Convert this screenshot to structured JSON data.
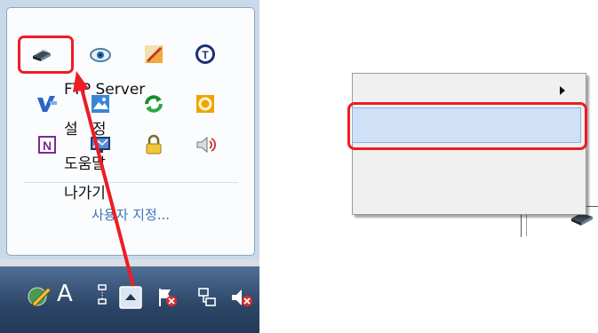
{
  "flyout": {
    "customize_label": "사용자 지정...",
    "icons": [
      "app-tray-icon",
      "eye-icon",
      "colorpicker-icon",
      "t-circle-icon",
      "vs-icon",
      "picture-icon",
      "green-sync-icon",
      "outlook-icon",
      "onenote-icon",
      "monitor-icon",
      "lock-icon",
      "speaker-icon"
    ]
  },
  "taskbar": {
    "font_label": "A",
    "icons": [
      "pencil-icon",
      "font-icon",
      "network-small-icon",
      "show-hidden-icons-button",
      "action-center-flag-icon",
      "network-icon",
      "volume-muted-icon"
    ]
  },
  "context_menu": {
    "items": [
      {
        "label": "FTP Server",
        "has_submenu": true
      },
      {
        "label": "설   정",
        "selected": true
      },
      {
        "label": "도움말"
      },
      {
        "label": "나가기"
      }
    ]
  },
  "colors": {
    "highlight_red": "#ee1c25",
    "selection_blue": "#cfe0f7",
    "link_blue": "#3b73b9"
  }
}
